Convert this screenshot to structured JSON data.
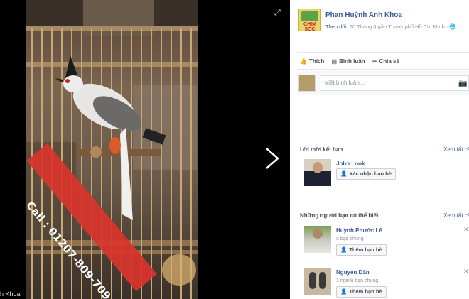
{
  "post": {
    "author": "Phan Huỳnh Anh Khoa",
    "follow_label": "Theo dõi",
    "meta": "· 20 Tháng 4 gần Thanh phố Hồ Chí Minh · ",
    "page_logo_text": "CHIM SÓC"
  },
  "photo": {
    "watermark": "Call : 01207-809-709",
    "owner_caption": "h Khoa"
  },
  "actions": {
    "like": "Thích",
    "comment": "Bình luận",
    "share": "Chia sẻ"
  },
  "comment": {
    "placeholder": "Viết bình luận..."
  },
  "friend_requests": {
    "title": "Lời mời kết bạn",
    "see_all": "Xem tất cả",
    "items": [
      {
        "name": "John Look",
        "button": "Xác nhận bạn bè"
      }
    ]
  },
  "people_you_may_know": {
    "title": "Những người bạn có thể biết",
    "see_all": "Xem tất cả",
    "items": [
      {
        "name": "Huỳnh Phước Lê",
        "mutual": "5 bạn chung",
        "button": "Thêm bạn bè"
      },
      {
        "name": "Nguyen Dân",
        "mutual": "1 người bạn chung",
        "button": "Thêm bạn bè"
      }
    ]
  },
  "colors": {
    "link": "#3b5998",
    "muted": "#90949c",
    "ribbon": "#d9342b"
  },
  "icons": [
    "expand-icon",
    "next-arrow-icon",
    "like-icon",
    "comment-icon",
    "share-icon",
    "camera-icon",
    "emoji-icon",
    "add-friend-icon",
    "close-icon",
    "globe-icon"
  ]
}
